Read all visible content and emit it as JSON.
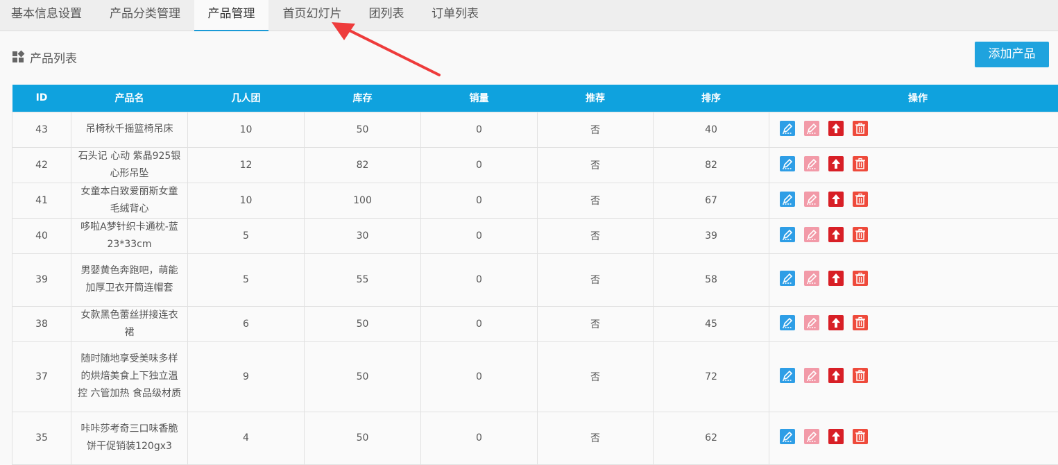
{
  "tabs": [
    {
      "label": "基本信息设置",
      "active": false
    },
    {
      "label": "产品分类管理",
      "active": false
    },
    {
      "label": "产品管理",
      "active": true
    },
    {
      "label": "首页幻灯片",
      "active": false
    },
    {
      "label": "团列表",
      "active": false
    },
    {
      "label": "订单列表",
      "active": false
    }
  ],
  "panel": {
    "title": "产品列表",
    "icon": "grid-icon",
    "add_button_label": "添加产品"
  },
  "table": {
    "columns": [
      "ID",
      "产品名",
      "几人团",
      "库存",
      "销量",
      "推荐",
      "排序",
      "操作"
    ],
    "rows": [
      {
        "id": "43",
        "name": "吊椅秋千摇篮椅吊床",
        "group": "10",
        "stock": "50",
        "sales": "0",
        "recommend": "否",
        "sort": "40"
      },
      {
        "id": "42",
        "name": "石头记 心动 紫晶925银心形吊坠",
        "group": "12",
        "stock": "82",
        "sales": "0",
        "recommend": "否",
        "sort": "82"
      },
      {
        "id": "41",
        "name": "女童本白致爱丽斯女童毛绒背心",
        "group": "10",
        "stock": "100",
        "sales": "0",
        "recommend": "否",
        "sort": "67"
      },
      {
        "id": "40",
        "name": "哆啦A梦针织卡通枕-蓝 23*33cm",
        "group": "5",
        "stock": "30",
        "sales": "0",
        "recommend": "否",
        "sort": "39"
      },
      {
        "id": "39",
        "name": "男婴黄色奔跑吧，萌能加厚卫衣开筒连帽套",
        "group": "5",
        "stock": "55",
        "sales": "0",
        "recommend": "否",
        "sort": "58"
      },
      {
        "id": "38",
        "name": "女款黑色蕾丝拼接连衣裙",
        "group": "6",
        "stock": "50",
        "sales": "0",
        "recommend": "否",
        "sort": "45"
      },
      {
        "id": "37",
        "name": "随时随地享受美味多样的烘焙美食上下独立温控 六管加热 食品级材质",
        "group": "9",
        "stock": "50",
        "sales": "0",
        "recommend": "否",
        "sort": "72"
      },
      {
        "id": "35",
        "name": "咔咔莎考奇三口味香脆饼干促销装120gx3",
        "group": "4",
        "stock": "50",
        "sales": "0",
        "recommend": "否",
        "sort": "62"
      }
    ],
    "actions": [
      {
        "name": "edit-icon",
        "color": "#2e9ee6"
      },
      {
        "name": "edit-alt-icon",
        "color": "#f29aa8"
      },
      {
        "name": "arrow-up-icon",
        "color": "#d81f26"
      },
      {
        "name": "trash-icon",
        "color": "#ee4a3b"
      }
    ]
  },
  "colors": {
    "accent": "#1fa3de",
    "header_bg": "#0fa2de",
    "annotation_arrow": "#ee3b3b"
  }
}
